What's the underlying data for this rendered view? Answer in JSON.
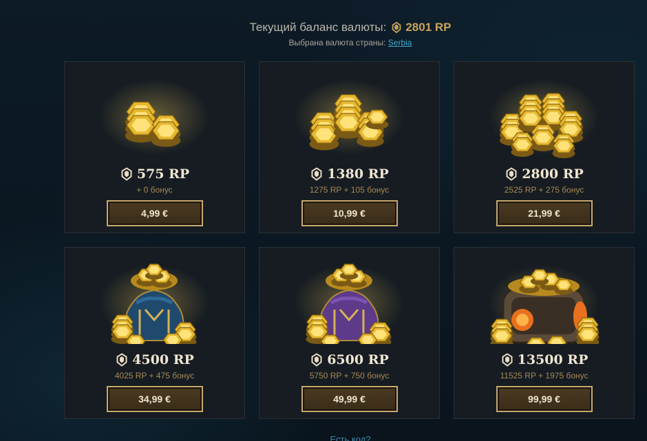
{
  "header": {
    "balance_label": "Текущий баланс валюты:",
    "balance_value": "2801 RP",
    "country_label": "Выбрана валюта страны:",
    "country_link": "Serbia"
  },
  "bundles": [
    {
      "rp": "575 RP",
      "bonus": "+ 0 бонус",
      "price": "4,99 €",
      "art": "coins-small"
    },
    {
      "rp": "1380 RP",
      "bonus": "1275 RP + 105 бонус",
      "price": "10,99 €",
      "art": "coins-medium"
    },
    {
      "rp": "2800 RP",
      "bonus": "2525 RP + 275 бонус",
      "price": "21,99 €",
      "art": "coins-large"
    },
    {
      "rp": "4500 RP",
      "bonus": "4025 RP + 475 бонус",
      "price": "34,99 €",
      "art": "blue-bag"
    },
    {
      "rp": "6500 RP",
      "bonus": "5750 RP + 750 бонус",
      "price": "49,99 €",
      "art": "purple-bag"
    },
    {
      "rp": "13500 RP",
      "bonus": "11525 RP + 1975 бонус",
      "price": "99,99 €",
      "art": "treasure-chest"
    }
  ],
  "footer": {
    "code_link": "Есть код?"
  },
  "colors": {
    "gold": "#c8aa6e",
    "bonus": "#a88a55",
    "link": "#3fa8cf"
  }
}
